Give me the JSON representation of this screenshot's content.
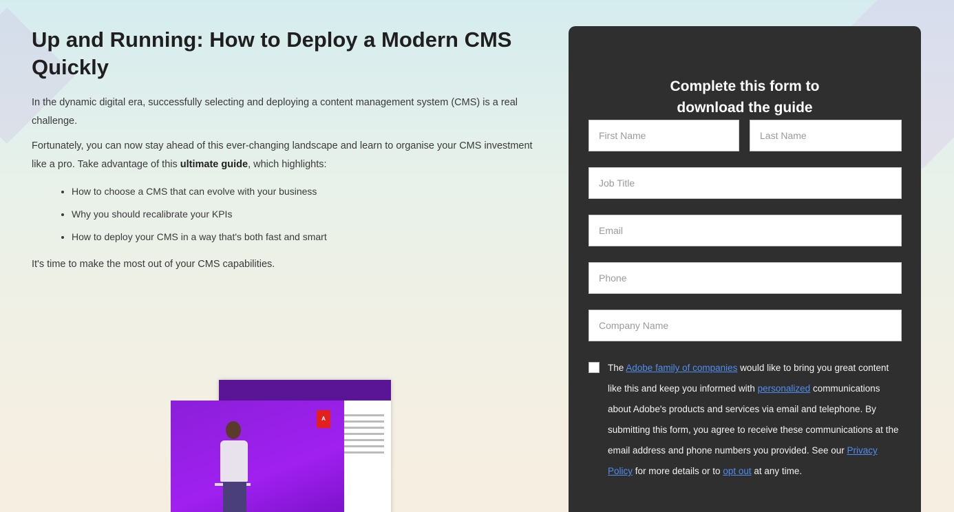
{
  "page": {
    "title": "Up and Running: How to Deploy a Modern CMS Quickly",
    "intro": "In the dynamic digital era, successfully selecting and deploying a content management system (CMS) is a real challenge.",
    "para2_prefix": "Fortunately, you can now stay ahead of this ever-changing landscape and learn to organise your CMS investment like a pro. Take advantage of this ",
    "para2_bold": "ultimate guide",
    "para2_suffix": ", which highlights:",
    "bullets": [
      "How to choose a CMS that can evolve with your business",
      "Why you should recalibrate your KPIs",
      "How to deploy your CMS in a way that's both fast and smart"
    ],
    "closing": "It's time to make the most out of your CMS capabilities.",
    "cover_badge": "A"
  },
  "form": {
    "heading_line1": "Complete this form to",
    "heading_line2": "download the guide",
    "first_name_placeholder": "First Name",
    "last_name_placeholder": "Last Name",
    "job_title_placeholder": "Job Title",
    "email_placeholder": "Email",
    "phone_placeholder": "Phone",
    "company_placeholder": "Company Name",
    "consent": {
      "t1": "The ",
      "link1": "Adobe family of companies",
      "t2": " would like to bring you great content like this and keep you informed with ",
      "link2": "personalized",
      "t3": " communications about Adobe's products and services via email and telephone. By submitting this form, you agree to receive these communications at the email address and phone numbers you provided. See our ",
      "link3": "Privacy Policy",
      "t4": " for more details or to ",
      "link4": "opt out",
      "t5": " at any time."
    }
  },
  "colors": {
    "form_bg": "#2f2f2f",
    "link": "#4d8ef0",
    "cover_purple": "#a020f0",
    "adobe_red": "#e4201f"
  }
}
